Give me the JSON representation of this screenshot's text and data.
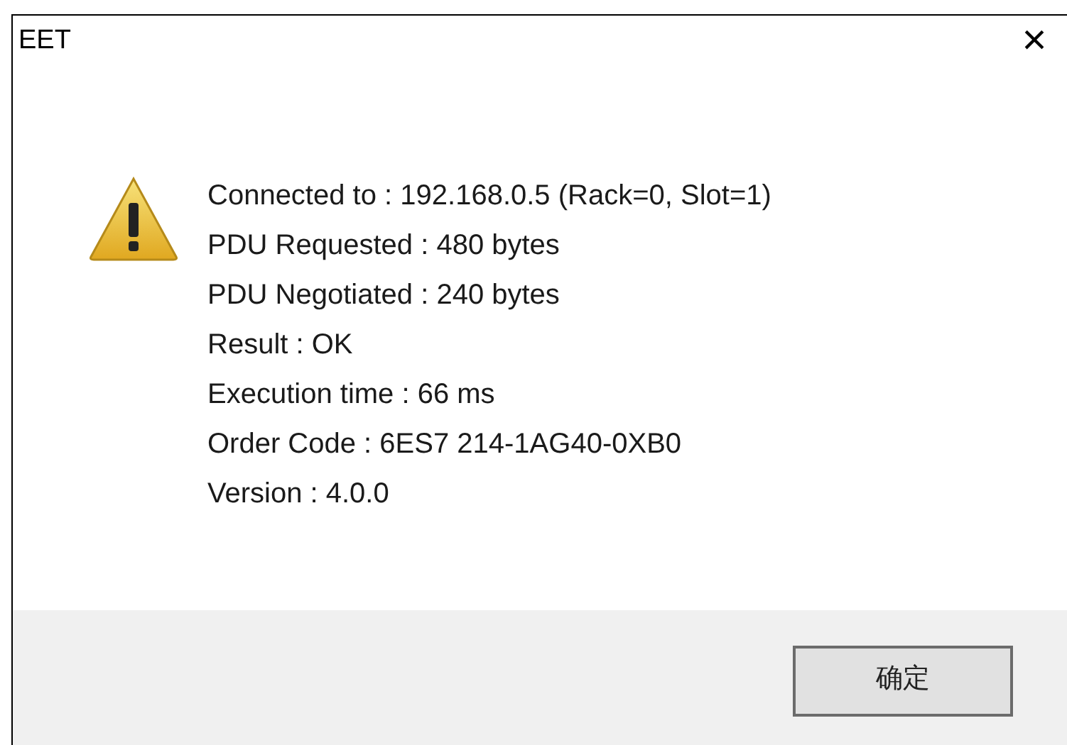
{
  "window": {
    "title": "EET",
    "close": "×"
  },
  "message": {
    "lines": [
      "Connected to : 192.168.0.5 (Rack=0, Slot=1)",
      "PDU Requested : 480 bytes",
      "PDU Negotiated : 240 bytes",
      "Result : OK",
      "Execution time : 66 ms",
      "Order Code : 6ES7 214-1AG40-0XB0",
      "Version : 4.0.0"
    ]
  },
  "buttons": [
    "确定"
  ]
}
